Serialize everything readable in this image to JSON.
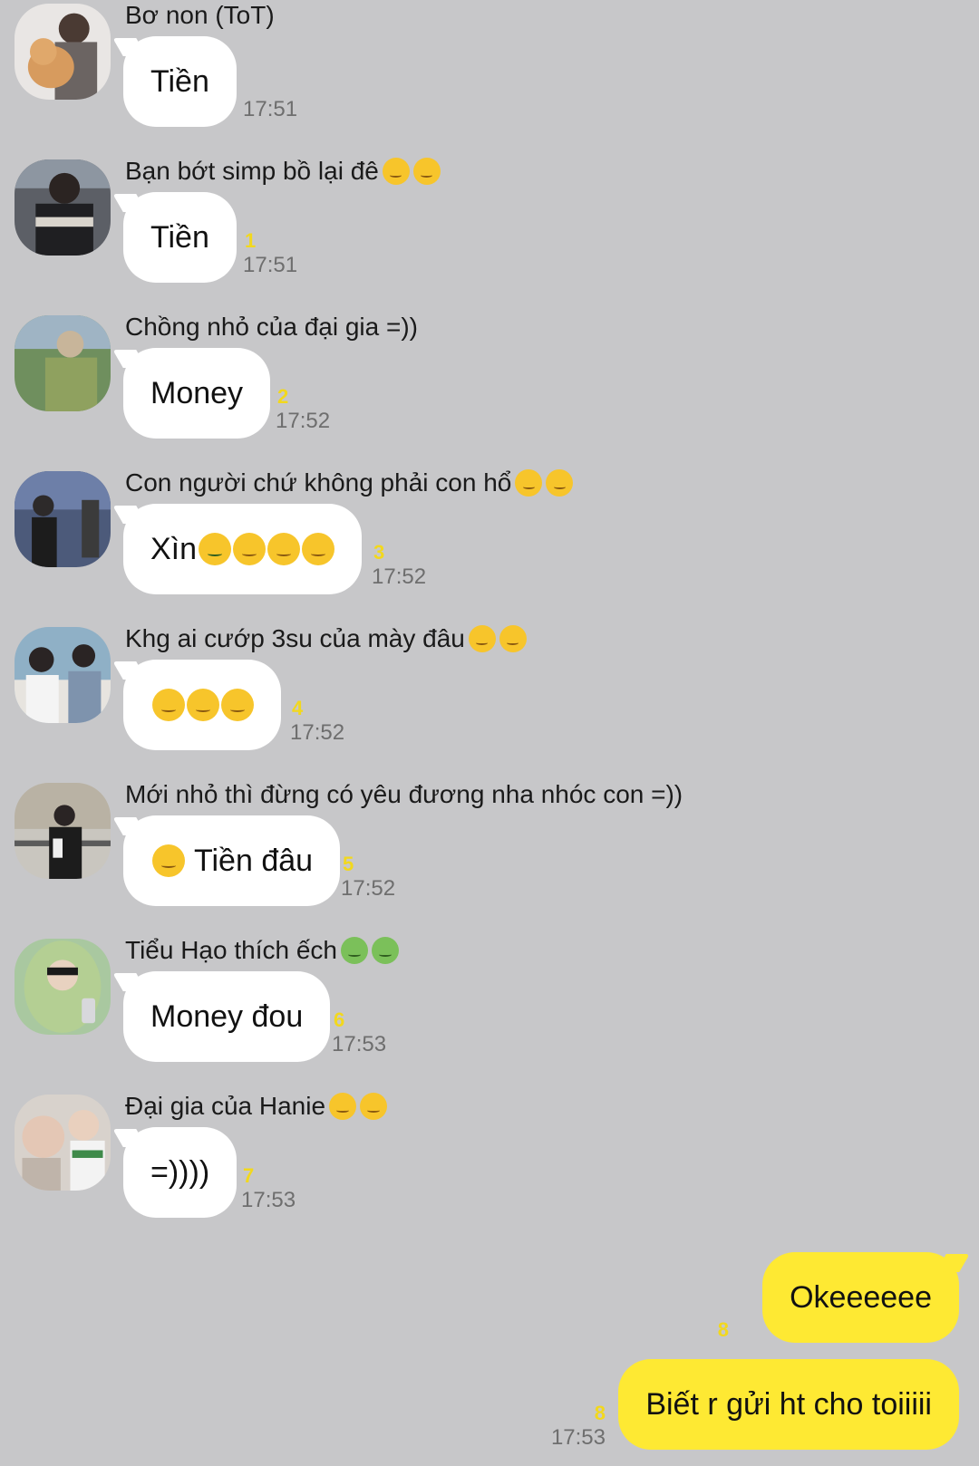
{
  "colors": {
    "background": "#c7c7c9",
    "incoming_bubble": "#ffffff",
    "outgoing_bubble": "#fee933",
    "read_count": "#f2d81d",
    "timestamp": "#6e6e6e"
  },
  "messages": [
    {
      "sender": "Bơ non (ToT)",
      "sender_emoji": [],
      "text": "Tiền",
      "text_emoji": [],
      "unread": "",
      "time": "17:51"
    },
    {
      "sender": "Bạn bớt simp bồ lại đê",
      "sender_emoji": [
        "raised-eyebrow-emoji",
        "raised-eyebrow-emoji"
      ],
      "text": "Tiền",
      "text_emoji": [],
      "unread": "1",
      "time": "17:51"
    },
    {
      "sender": "Chồng nhỏ của đại gia =))",
      "sender_emoji": [],
      "text": "Money",
      "text_emoji": [],
      "unread": "2",
      "time": "17:52"
    },
    {
      "sender": "Con người chứ không phải con hổ",
      "sender_emoji": [
        "relieved-face-emoji",
        "relieved-face-emoji"
      ],
      "text": "Xìn",
      "text_emoji": [
        "money-mouth-emoji",
        "money-mouth-emoji",
        "money-mouth-emoji",
        "money-mouth-emoji"
      ],
      "unread": "3",
      "time": "17:52"
    },
    {
      "sender": "Khg ai cướp 3su của mày đâu",
      "sender_emoji": [
        "yawning-face-emoji",
        "yawning-face-emoji"
      ],
      "text": "",
      "text_emoji": [
        "pensive-face-emoji",
        "pensive-face-emoji",
        "pensive-face-emoji"
      ],
      "unread": "4",
      "time": "17:52"
    },
    {
      "sender": "Mới nhỏ thì đừng có yêu đương nha nhóc con =))",
      "sender_emoji": [],
      "text": "Tiền đâu",
      "text_emoji_before": [
        "hugging-face-emoji"
      ],
      "text_emoji": [],
      "unread": "5",
      "time": "17:52"
    },
    {
      "sender": "Tiểu Hạo thích ếch",
      "sender_emoji": [
        "frog-emoji",
        "frog-emoji"
      ],
      "text": "Money đou",
      "text_emoji": [],
      "unread": "6",
      "time": "17:53"
    },
    {
      "sender": "Đại gia của Hanie",
      "sender_emoji": [
        "money-mouth-emoji",
        "money-mouth-emoji"
      ],
      "text": "=))))",
      "text_emoji": [],
      "unread": "7",
      "time": "17:53"
    }
  ],
  "my_messages": [
    {
      "text": "Okeeeeee",
      "unread": "8",
      "time": ""
    },
    {
      "text": "Biết r gửi ht cho toiiiii",
      "unread": "8",
      "time": "17:53"
    }
  ]
}
